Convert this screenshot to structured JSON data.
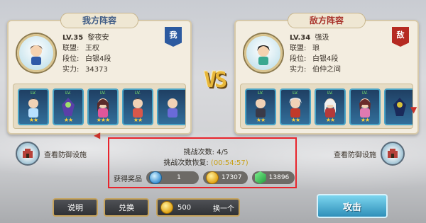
{
  "colors": {
    "highlight": "#e8242c",
    "ally": "#2c5aa0",
    "enemy": "#b52a22",
    "gold": "#e2a414"
  },
  "ally": {
    "title": "我方阵容",
    "badge": "我",
    "level": "LV.35",
    "name": "黎夜安",
    "alliance_label": "联盟:",
    "alliance": "王权",
    "rank_label": "段位:",
    "rank": "白银4段",
    "power_label": "实力:",
    "power": "34373",
    "heroes": [
      {
        "icon": "hero-portrait",
        "pos": "LV.",
        "stars": "★★"
      },
      {
        "icon": "hero-portrait",
        "pos": "LV.",
        "stars": "★★"
      },
      {
        "icon": "hero-portrait",
        "pos": "LV.",
        "stars": "★★★"
      },
      {
        "icon": "hero-portrait",
        "pos": "LV.",
        "stars": "★★"
      },
      {
        "icon": "hero-portrait",
        "pos": "",
        "stars": ""
      }
    ],
    "defense": "查看防御设施"
  },
  "enemy": {
    "title": "敌方阵容",
    "badge": "敌",
    "level": "LV.34",
    "name": "强汲",
    "alliance_label": "联盟:",
    "alliance": "琅",
    "rank_label": "段位:",
    "rank": "白银4段",
    "power_label": "实力:",
    "power": "伯仲之间",
    "heroes": [
      {
        "icon": "hero-portrait",
        "pos": "LV.",
        "stars": "★★"
      },
      {
        "icon": "hero-portrait",
        "pos": "LV.",
        "stars": "★★"
      },
      {
        "icon": "hero-portrait",
        "pos": "LV.",
        "stars": "★★"
      },
      {
        "icon": "hero-portrait",
        "pos": "LV.",
        "stars": "★★"
      },
      {
        "icon": "hero-portrait",
        "pos": "",
        "stars": ""
      }
    ],
    "defense": "查看防御设施"
  },
  "vs": "VS",
  "challenge": {
    "count_label": "挑战次数:",
    "count": "4/5",
    "restore_label": "挑战次数恢复:",
    "restore_time": "(00:54:57)"
  },
  "rewards": {
    "label": "获得奖品",
    "items": [
      {
        "icon": "gem-icon",
        "value": "1"
      },
      {
        "icon": "coin-icon",
        "value": "17307"
      },
      {
        "icon": "jade-icon",
        "value": "13896"
      }
    ]
  },
  "bottom": {
    "explain": "说明",
    "exchange": "兑换",
    "coins": "500",
    "swap": "换一个",
    "attack": "攻击"
  }
}
